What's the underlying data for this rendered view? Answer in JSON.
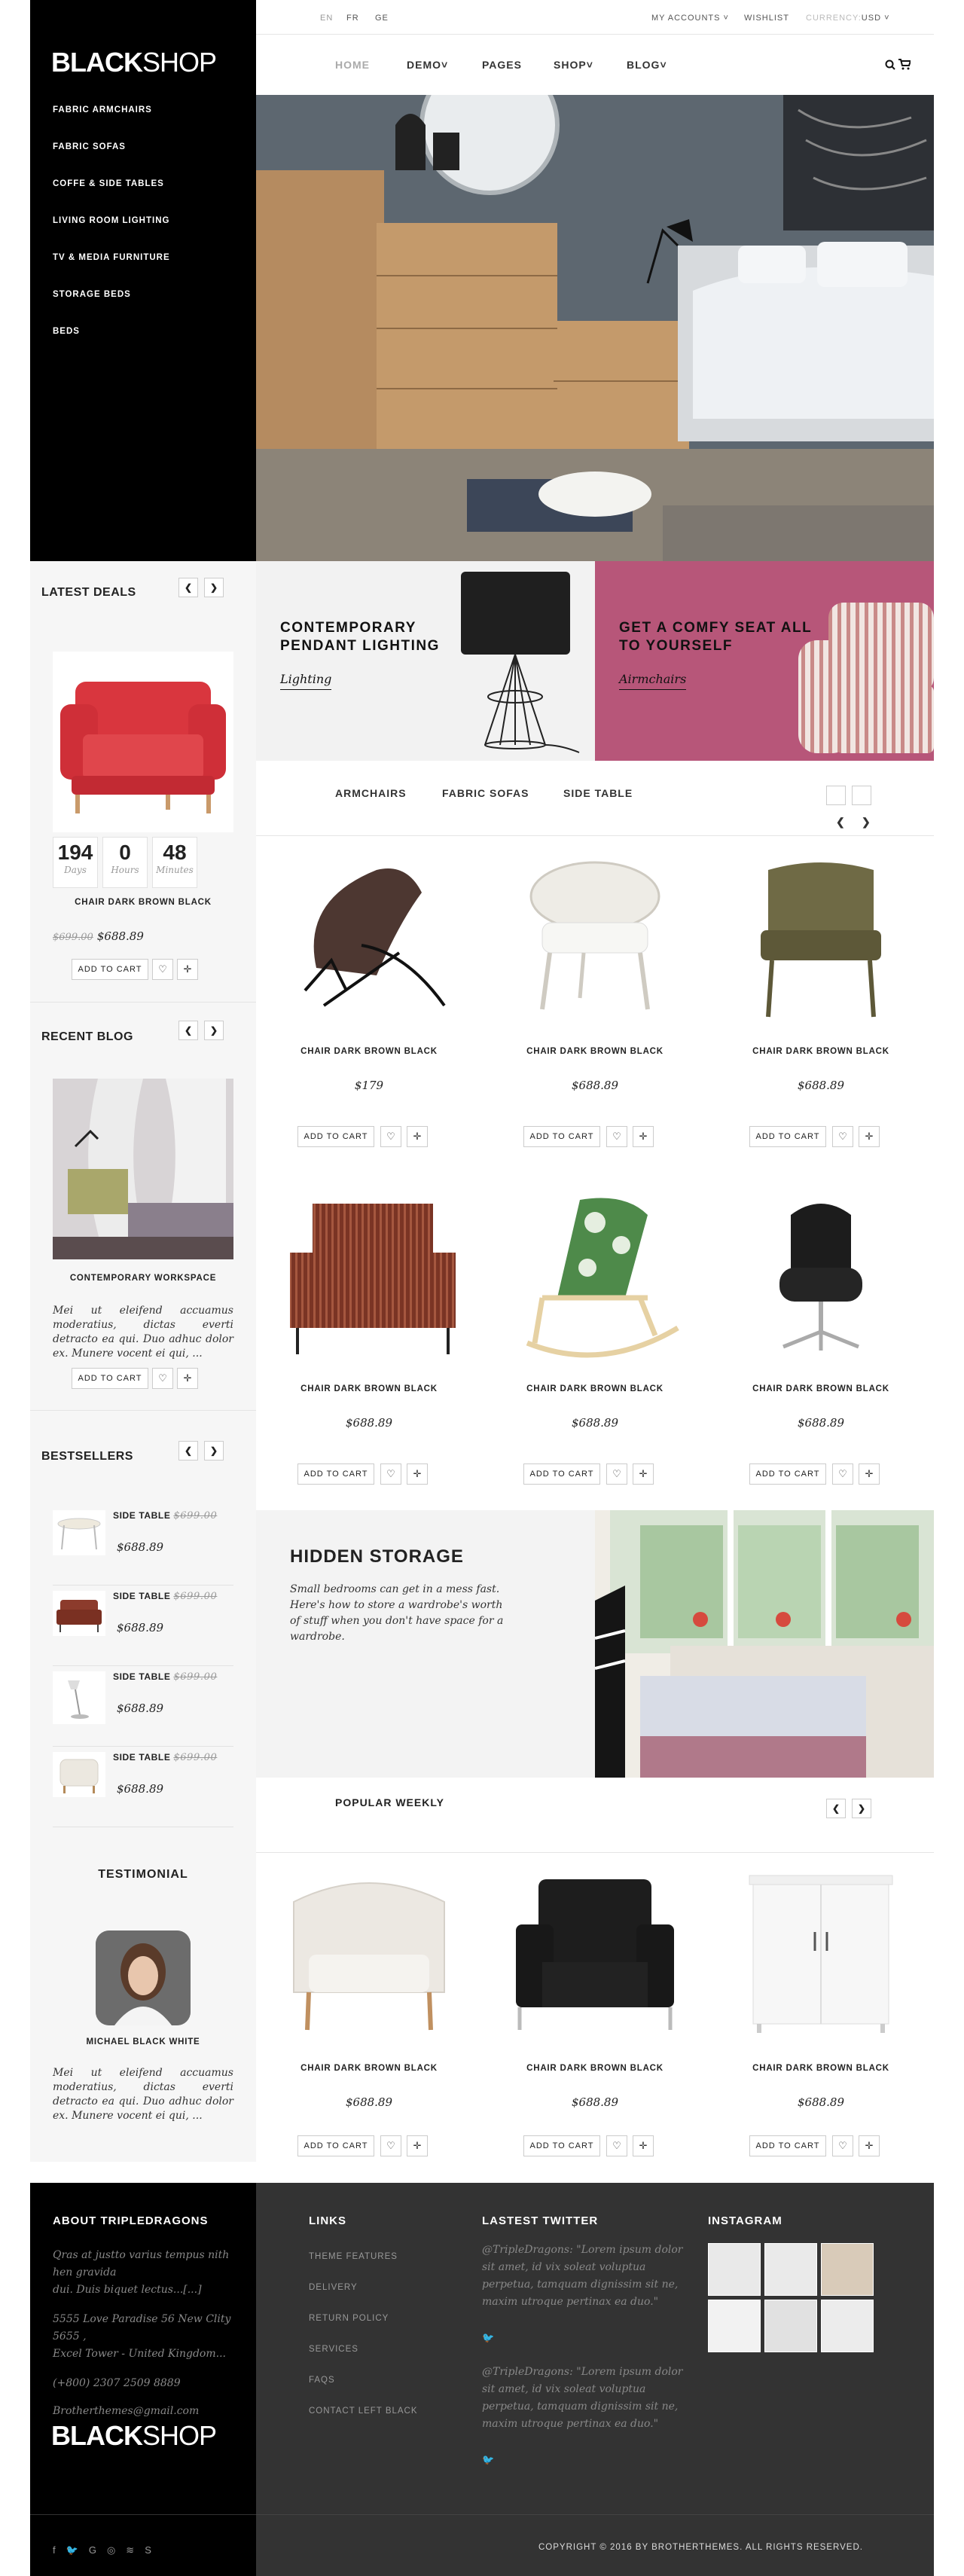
{
  "brand": {
    "logo_bold": "BLACK",
    "logo_thin": "SHOP"
  },
  "topbar": {
    "langs": [
      "EN",
      "FR",
      "GE"
    ],
    "my_accounts": "MY ACCOUNTS",
    "wishlist": "WISHLIST",
    "currency_label": "CURRENCY:",
    "currency": "USD"
  },
  "menu": {
    "items": [
      "HOME",
      "DEMO",
      "PAGES",
      "SHOP",
      "BLOG"
    ]
  },
  "categories": [
    "FABRIC ARMCHAIRS",
    "FABRIC SOFAS",
    "COFFE & SIDE TABLES",
    "LIVING ROOM LIGHTING",
    "TV & MEDIA FURNITURE",
    "STORAGE BEDS",
    "BEDS"
  ],
  "latest_deals": {
    "title": "LATEST DEALS",
    "days": "194",
    "days_label": "Days",
    "hours": "0",
    "hours_label": "Hours",
    "minutes": "48",
    "minutes_label": "Minutes",
    "product": "CHAIR DARK BROWN BLACK",
    "old_price": "$699.00",
    "price": "$688.89",
    "add_to_cart": "ADD TO CART"
  },
  "recent_blog": {
    "title": "RECENT BLOG",
    "post_title": "CONTEMPORARY WORKSPACE",
    "excerpt": "Mei ut eleifend accuamus moderatius, dictas everti detracto ea qui. Duo adhuc dolor ex. Munere vocent ei qui, ...",
    "add_to_cart": "ADD TO CART"
  },
  "bestsellers": {
    "title": "BESTSELLERS",
    "items": [
      {
        "name": "SIDE TABLE",
        "old_price": "$699.00",
        "price": "$688.89"
      },
      {
        "name": "SIDE TABLE",
        "old_price": "$699.00",
        "price": "$688.89"
      },
      {
        "name": "SIDE TABLE",
        "old_price": "$699.00",
        "price": "$688.89"
      },
      {
        "name": "SIDE TABLE",
        "old_price": "$699.00",
        "price": "$688.89"
      }
    ]
  },
  "testimonial": {
    "title": "TESTIMONIAL",
    "name": "MICHAEL BLACK WHITE",
    "text": "Mei ut eleifend accuamus moderatius, dictas everti detracto ea qui. Duo adhuc dolor ex. Munere vocent ei qui, ..."
  },
  "promos": [
    {
      "title_line1": "CONTEMPORARY",
      "title_line2": "PENDANT LIGHTING",
      "sub": "Lighting"
    },
    {
      "title_line1": "GET A COMFY SEAT ALL",
      "title_line2": "TO YOURSELF",
      "sub": "Airmchairs"
    }
  ],
  "tabs": [
    "ARMCHAIRS",
    "FABRIC SOFAS",
    "SIDE TABLE"
  ],
  "products": [
    {
      "name": "CHAIR DARK BROWN BLACK",
      "price": "$179",
      "add": "ADD TO CART"
    },
    {
      "name": "CHAIR DARK BROWN BLACK",
      "price": "$688.89",
      "add": "ADD TO CART"
    },
    {
      "name": "CHAIR DARK BROWN BLACK",
      "price": "$688.89",
      "add": "ADD TO CART"
    },
    {
      "name": "CHAIR DARK BROWN BLACK",
      "price": "$688.89",
      "add": "ADD TO CART"
    },
    {
      "name": "CHAIR DARK BROWN BLACK",
      "price": "$688.89",
      "add": "ADD TO CART"
    },
    {
      "name": "CHAIR DARK BROWN BLACK",
      "price": "$688.89",
      "add": "ADD TO CART"
    }
  ],
  "storage": {
    "title": "HIDDEN STORAGE",
    "text": "Small bedrooms can get in a mess fast. Here's how to store a wardrobe's worth of stuff when you don't have space for a wardrobe."
  },
  "popular": {
    "title": "POPULAR WEEKLY",
    "products": [
      {
        "name": "CHAIR DARK BROWN BLACK",
        "price": "$688.89",
        "add": "ADD TO CART"
      },
      {
        "name": "CHAIR DARK BROWN BLACK",
        "price": "$688.89",
        "add": "ADD TO CART"
      },
      {
        "name": "CHAIR DARK BROWN BLACK",
        "price": "$688.89",
        "add": "ADD TO CART"
      }
    ]
  },
  "footer": {
    "about_title": "ABOUT TRIPLEDRAGONS",
    "about_text1": "Qras at justto varius tempus nith",
    "about_text2": "hen gravida",
    "about_text3": "dui. Duis biquet lectus...[...]",
    "address1": "5555 Love Paradise 56 New Clity",
    "address2": "5655 ,",
    "address3": "Excel Tower - United Kingdom...",
    "phone": "(+800) 2307 2509 8889",
    "email": "Brotherthemes@gmail.com",
    "links_title": "LINKS",
    "links": [
      "THEME FEATURES",
      "DELIVERY",
      "RETURN POLICY",
      "SERVICES",
      "FAQS",
      "CONTACT LEFT BLACK"
    ],
    "twitter_title": "LASTEST TWITTER",
    "tweet1": "@TripleDragons: \"Lorem ipsum dolor sit amet, id vix soleat voluptua perpetua, tamquam dignissim sit ne, maxim utroque pertinax ea duo.\"",
    "tweet2": "@TripleDragons: \"Lorem ipsum dolor sit amet, id vix soleat voluptua perpetua, tamquam dignissim sit ne, maxim utroque pertinax ea duo.\"",
    "instagram_title": "INSTAGRAM",
    "copyright": "COPYRIGHT © 2016 BY BROTHERTHEMES. ALL RIGHTS RESERVED."
  }
}
